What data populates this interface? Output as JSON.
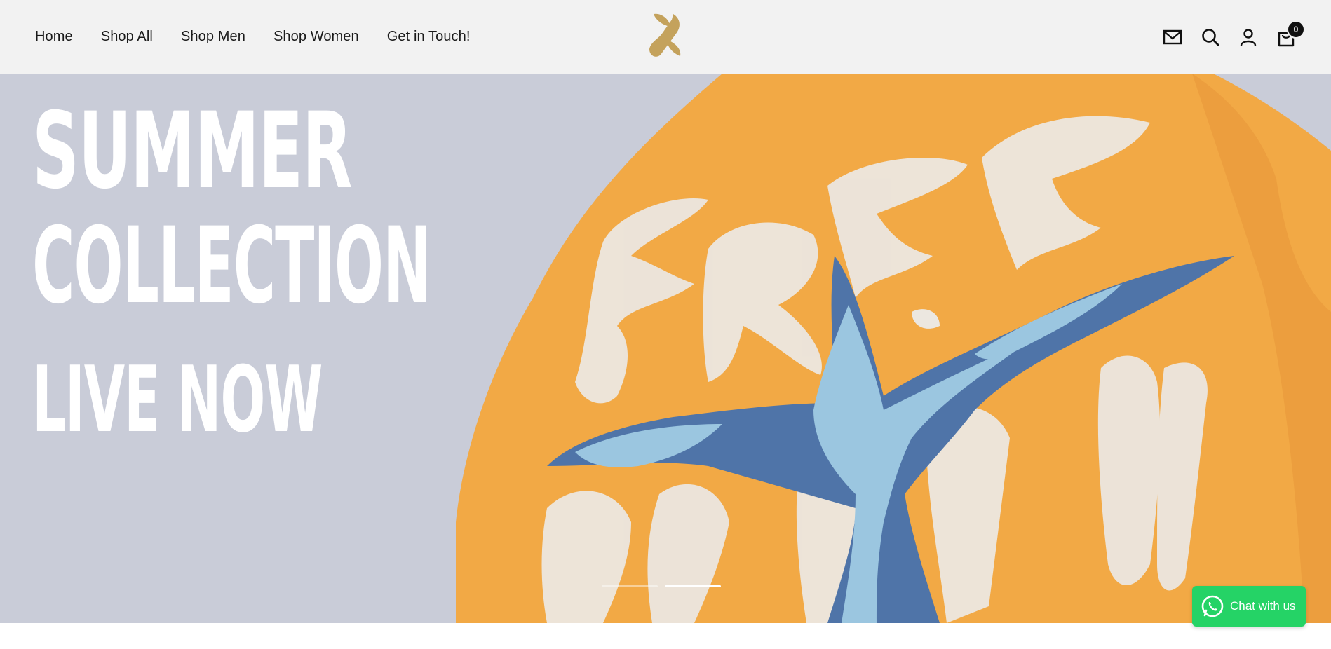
{
  "nav": {
    "items": [
      {
        "label": "Home"
      },
      {
        "label": "Shop All"
      },
      {
        "label": "Shop Men"
      },
      {
        "label": "Shop Women"
      },
      {
        "label": "Get in Touch!"
      }
    ]
  },
  "header": {
    "icons": [
      "mail-icon",
      "search-icon",
      "account-icon",
      "cart-icon"
    ],
    "cart_count": "0",
    "logo_color": "#c4a25c"
  },
  "hero": {
    "line1": "SUMMER",
    "line2": "COLLECTION",
    "line3": "LIVE NOW",
    "background_color": "#c9ccd8",
    "shirt_color": "#f2a945",
    "slides": 2,
    "active_slide": 2
  },
  "chat": {
    "label": "Chat with us",
    "color": "#25d366"
  }
}
